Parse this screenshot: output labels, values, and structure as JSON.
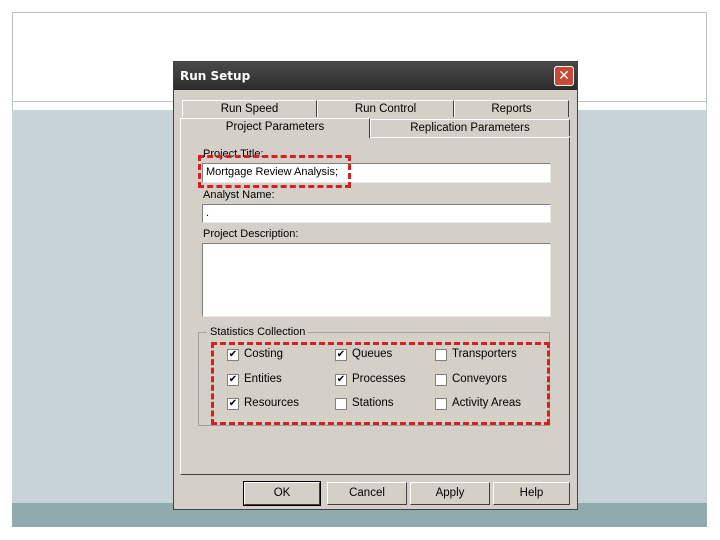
{
  "dialog": {
    "title": "Run Setup",
    "close_glyph": "✕"
  },
  "tabs": {
    "back_row": [
      "Run Speed",
      "Run Control",
      "Reports"
    ],
    "front_row": [
      "Project Parameters",
      "Replication Parameters"
    ],
    "active": "Project Parameters"
  },
  "form": {
    "project_title_label": "Project Title:",
    "project_title_value": "Mortgage Review Analysis;",
    "analyst_name_label": "Analyst Name:",
    "analyst_name_value": ".",
    "project_description_label": "Project Description:",
    "project_description_value": ""
  },
  "statistics": {
    "group_label": "Statistics Collection",
    "items": [
      {
        "label": "Costing",
        "checked": true
      },
      {
        "label": "Queues",
        "checked": true
      },
      {
        "label": "Transporters",
        "checked": false
      },
      {
        "label": "Entities",
        "checked": true
      },
      {
        "label": "Processes",
        "checked": true
      },
      {
        "label": "Conveyors",
        "checked": false
      },
      {
        "label": "Resources",
        "checked": true
      },
      {
        "label": "Stations",
        "checked": false
      },
      {
        "label": "Activity Areas",
        "checked": false
      }
    ]
  },
  "buttons": {
    "ok": "OK",
    "cancel": "Cancel",
    "apply": "Apply",
    "help": "Help"
  },
  "colors": {
    "highlight": "#d62020",
    "dialog_bg": "#d4d0c8",
    "close_red": "#c84a36"
  }
}
